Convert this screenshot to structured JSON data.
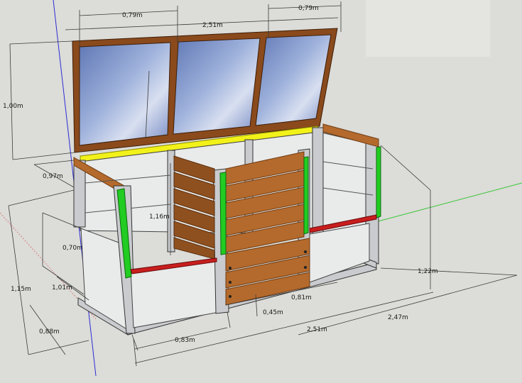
{
  "dimensions": {
    "lid_panel_width_left": "0,79m",
    "lid_panel_width_right": "0,79m",
    "lid_total_width": "2,51m",
    "lid_height": "1,00m",
    "depth_top": "0,97m",
    "inner_height": "1,16m",
    "lower_height": "0,70m",
    "side_depth": "1,01m",
    "front_height": "1,15m",
    "base_depth": "0,88m",
    "front_panel_width": "0,83m",
    "bin_width": "0,81m",
    "gap_height": "0,45m",
    "base_width": "2,51m",
    "base_length": "2,47m",
    "rear_height": "1,22m"
  },
  "colors": {
    "wood": "#b46a2c",
    "lid_frame": "#8a4a1c",
    "glass": "#7f93c4",
    "green_strip": "#22cc22",
    "red_rail": "#c81e1e",
    "yellow_strip": "#f2f21a",
    "metal": "#c9cbce"
  }
}
